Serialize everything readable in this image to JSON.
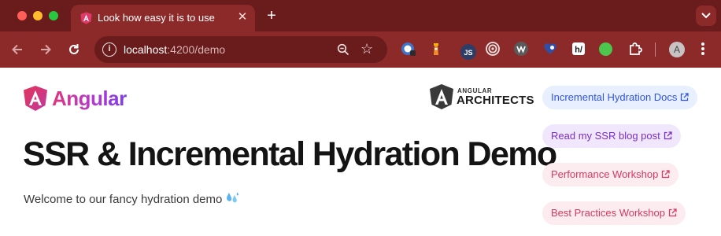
{
  "browser": {
    "tab_title": "Look how easy it is to use",
    "url_host": "localhost",
    "url_rest": ":4200/demo",
    "avatar_letter": "A",
    "extensions": [
      "ublock-origin-icon",
      "lighthouse-icon",
      "js-icon",
      "target-icon",
      "wappalyzer-icon",
      "heart-icon",
      "h-extension-icon",
      "green-dot-icon",
      "puzzle-icon"
    ]
  },
  "page": {
    "brand": "Angular",
    "partner": {
      "line1": "ANGULAR",
      "line2": "ARCHITECTS"
    },
    "headline": "SSR & Incremental Hydration Demo",
    "subtitle": "Welcome to our fancy hydration demo",
    "links": [
      {
        "label": "Incremental Hydration Docs"
      },
      {
        "label": "Read my SSR blog post"
      },
      {
        "label": "Performance Workshop"
      },
      {
        "label": "Best Practices Workshop"
      }
    ]
  },
  "colors": {
    "tabstrip": "#6a1b1b",
    "toolbar": "#8c2a2a",
    "docs_pill": "#2f55e6",
    "blog_pill": "#7a2fc8",
    "workshop_pill": "#d33b5f"
  }
}
